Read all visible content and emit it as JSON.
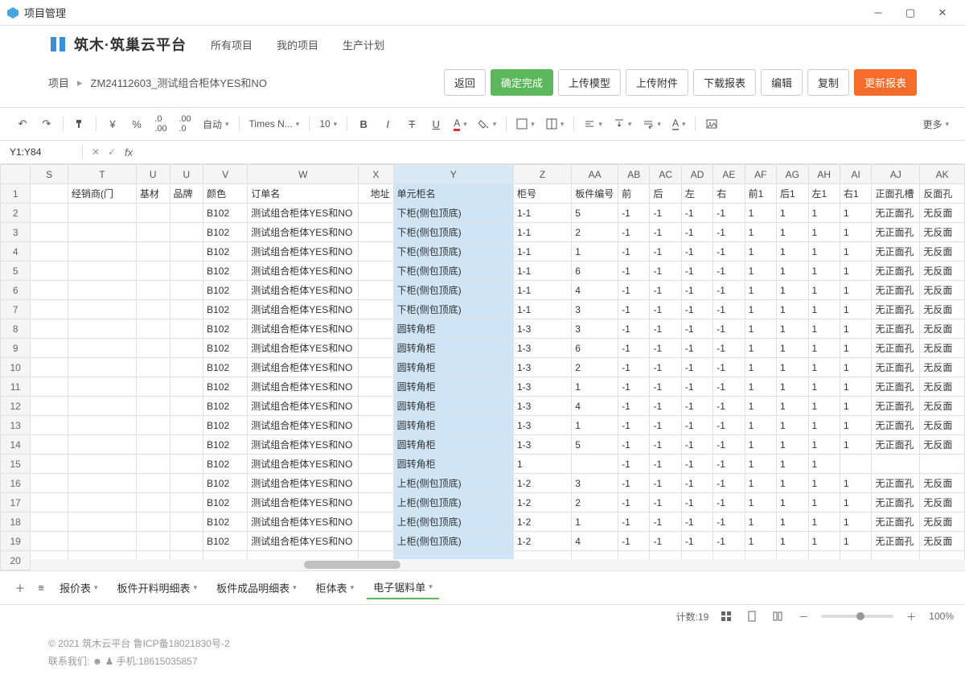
{
  "window": {
    "title": "项目管理"
  },
  "header": {
    "brand": "筑木·筑巢云平台",
    "nav": [
      "所有项目",
      "我的项目",
      "生产计划"
    ]
  },
  "breadcrumb": {
    "root": "项目",
    "current": "ZM24112603_测试组合柜体YES和NO"
  },
  "actions": {
    "back": "返回",
    "confirm": "确定完成",
    "uploadModel": "上传模型",
    "uploadAttach": "上传附件",
    "downloadReport": "下载报表",
    "edit": "编辑",
    "copy": "复制",
    "refresh": "更新报表"
  },
  "toolbar": {
    "autoWrap": "自动",
    "font": "Times N...",
    "fontSize": "10",
    "more": "更多"
  },
  "formula": {
    "cellRef": "Y1:Y84"
  },
  "columns": [
    "S",
    "T",
    "U",
    "U",
    "V",
    "W",
    "X",
    "Y",
    "Z",
    "AA",
    "AB",
    "AC",
    "AD",
    "AE",
    "AF",
    "AG",
    "AH",
    "AI",
    "AJ",
    "AK"
  ],
  "headerRow": [
    "",
    "经销商(门",
    "基材",
    "品牌",
    "颜色",
    "订单名",
    "地址",
    "单元柜名",
    "柜号",
    "板件编号",
    "前",
    "后",
    "左",
    "右",
    "前1",
    "后1",
    "左1",
    "右1",
    "正面孔槽",
    "反面孔"
  ],
  "rows": [
    {
      "v": "B102",
      "w": "测试组合柜体YES和NO",
      "y": "下柜(侧包顶底)",
      "z": "1-1",
      "aa": "5",
      "ab": "-1",
      "ac": "-1",
      "ad": "-1",
      "ae": "-1",
      "af": "1",
      "ag": "1",
      "ah": "1",
      "ai": "1",
      "aj": "无正面孔",
      "ak": "无反面"
    },
    {
      "v": "B102",
      "w": "测试组合柜体YES和NO",
      "y": "下柜(侧包顶底)",
      "z": "1-1",
      "aa": "2",
      "ab": "-1",
      "ac": "-1",
      "ad": "-1",
      "ae": "-1",
      "af": "1",
      "ag": "1",
      "ah": "1",
      "ai": "1",
      "aj": "无正面孔",
      "ak": "无反面"
    },
    {
      "v": "B102",
      "w": "测试组合柜体YES和NO",
      "y": "下柜(侧包顶底)",
      "z": "1-1",
      "aa": "1",
      "ab": "-1",
      "ac": "-1",
      "ad": "-1",
      "ae": "-1",
      "af": "1",
      "ag": "1",
      "ah": "1",
      "ai": "1",
      "aj": "无正面孔",
      "ak": "无反面"
    },
    {
      "v": "B102",
      "w": "测试组合柜体YES和NO",
      "y": "下柜(侧包顶底)",
      "z": "1-1",
      "aa": "6",
      "ab": "-1",
      "ac": "-1",
      "ad": "-1",
      "ae": "-1",
      "af": "1",
      "ag": "1",
      "ah": "1",
      "ai": "1",
      "aj": "无正面孔",
      "ak": "无反面"
    },
    {
      "v": "B102",
      "w": "测试组合柜体YES和NO",
      "y": "下柜(侧包顶底)",
      "z": "1-1",
      "aa": "4",
      "ab": "-1",
      "ac": "-1",
      "ad": "-1",
      "ae": "-1",
      "af": "1",
      "ag": "1",
      "ah": "1",
      "ai": "1",
      "aj": "无正面孔",
      "ak": "无反面"
    },
    {
      "v": "B102",
      "w": "测试组合柜体YES和NO",
      "y": "下柜(侧包顶底)",
      "z": "1-1",
      "aa": "3",
      "ab": "-1",
      "ac": "-1",
      "ad": "-1",
      "ae": "-1",
      "af": "1",
      "ag": "1",
      "ah": "1",
      "ai": "1",
      "aj": "无正面孔",
      "ak": "无反面"
    },
    {
      "v": "B102",
      "w": "测试组合柜体YES和NO",
      "y": "圆转角柜",
      "z": "1-3",
      "aa": "3",
      "ab": "-1",
      "ac": "-1",
      "ad": "-1",
      "ae": "-1",
      "af": "1",
      "ag": "1",
      "ah": "1",
      "ai": "1",
      "aj": "无正面孔",
      "ak": "无反面"
    },
    {
      "v": "B102",
      "w": "测试组合柜体YES和NO",
      "y": "圆转角柜",
      "z": "1-3",
      "aa": "6",
      "ab": "-1",
      "ac": "-1",
      "ad": "-1",
      "ae": "-1",
      "af": "1",
      "ag": "1",
      "ah": "1",
      "ai": "1",
      "aj": "无正面孔",
      "ak": "无反面"
    },
    {
      "v": "B102",
      "w": "测试组合柜体YES和NO",
      "y": "圆转角柜",
      "z": "1-3",
      "aa": "2",
      "ab": "-1",
      "ac": "-1",
      "ad": "-1",
      "ae": "-1",
      "af": "1",
      "ag": "1",
      "ah": "1",
      "ai": "1",
      "aj": "无正面孔",
      "ak": "无反面"
    },
    {
      "v": "B102",
      "w": "测试组合柜体YES和NO",
      "y": "圆转角柜",
      "z": "1-3",
      "aa": "1",
      "ab": "-1",
      "ac": "-1",
      "ad": "-1",
      "ae": "-1",
      "af": "1",
      "ag": "1",
      "ah": "1",
      "ai": "1",
      "aj": "无正面孔",
      "ak": "无反面"
    },
    {
      "v": "B102",
      "w": "测试组合柜体YES和NO",
      "y": "圆转角柜",
      "z": "1-3",
      "aa": "4",
      "ab": "-1",
      "ac": "-1",
      "ad": "-1",
      "ae": "-1",
      "af": "1",
      "ag": "1",
      "ah": "1",
      "ai": "1",
      "aj": "无正面孔",
      "ak": "无反面"
    },
    {
      "v": "B102",
      "w": "测试组合柜体YES和NO",
      "y": "圆转角柜",
      "z": "1-3",
      "aa": "1",
      "ab": "-1",
      "ac": "-1",
      "ad": "-1",
      "ae": "-1",
      "af": "1",
      "ag": "1",
      "ah": "1",
      "ai": "1",
      "aj": "无正面孔",
      "ak": "无反面"
    },
    {
      "v": "B102",
      "w": "测试组合柜体YES和NO",
      "y": "圆转角柜",
      "z": "1-3",
      "aa": "5",
      "ab": "-1",
      "ac": "-1",
      "ad": "-1",
      "ae": "-1",
      "af": "1",
      "ag": "1",
      "ah": "1",
      "ai": "1",
      "aj": "无正面孔",
      "ak": "无反面"
    },
    {
      "v": "B102",
      "w": "测试组合柜体YES和NO",
      "y": "圆转角柜",
      "z": "1",
      "aa": "",
      "ab": "-1",
      "ac": "-1",
      "ad": "-1",
      "ae": "-1",
      "af": "1",
      "ag": "1",
      "ah": "1",
      "ai": "",
      "aj": "",
      "ak": ""
    },
    {
      "v": "B102",
      "w": "测试组合柜体YES和NO",
      "y": "上柜(侧包顶底)",
      "z": "1-2",
      "aa": "3",
      "ab": "-1",
      "ac": "-1",
      "ad": "-1",
      "ae": "-1",
      "af": "1",
      "ag": "1",
      "ah": "1",
      "ai": "1",
      "aj": "无正面孔",
      "ak": "无反面"
    },
    {
      "v": "B102",
      "w": "测试组合柜体YES和NO",
      "y": "上柜(侧包顶底)",
      "z": "1-2",
      "aa": "2",
      "ab": "-1",
      "ac": "-1",
      "ad": "-1",
      "ae": "-1",
      "af": "1",
      "ag": "1",
      "ah": "1",
      "ai": "1",
      "aj": "无正面孔",
      "ak": "无反面"
    },
    {
      "v": "B102",
      "w": "测试组合柜体YES和NO",
      "y": "上柜(侧包顶底)",
      "z": "1-2",
      "aa": "1",
      "ab": "-1",
      "ac": "-1",
      "ad": "-1",
      "ae": "-1",
      "af": "1",
      "ag": "1",
      "ah": "1",
      "ai": "1",
      "aj": "无正面孔",
      "ak": "无反面"
    },
    {
      "v": "B102",
      "w": "测试组合柜体YES和NO",
      "y": "上柜(侧包顶底)",
      "z": "1-2",
      "aa": "4",
      "ab": "-1",
      "ac": "-1",
      "ad": "-1",
      "ae": "-1",
      "af": "1",
      "ag": "1",
      "ah": "1",
      "ai": "1",
      "aj": "无正面孔",
      "ak": "无反面"
    }
  ],
  "tabs": [
    "报价表",
    "板件开料明细表",
    "板件成品明细表",
    "柜体表",
    "电子锯料单"
  ],
  "activeTab": 4,
  "status": {
    "count": "计数:19",
    "zoom": "100%"
  },
  "footer": {
    "copyright": "© 2021 筑木云平台",
    "icp": "鲁ICP备18021830号-2",
    "contactLabel": "联系我们:",
    "phoneLabel": "手机:18615035857"
  }
}
